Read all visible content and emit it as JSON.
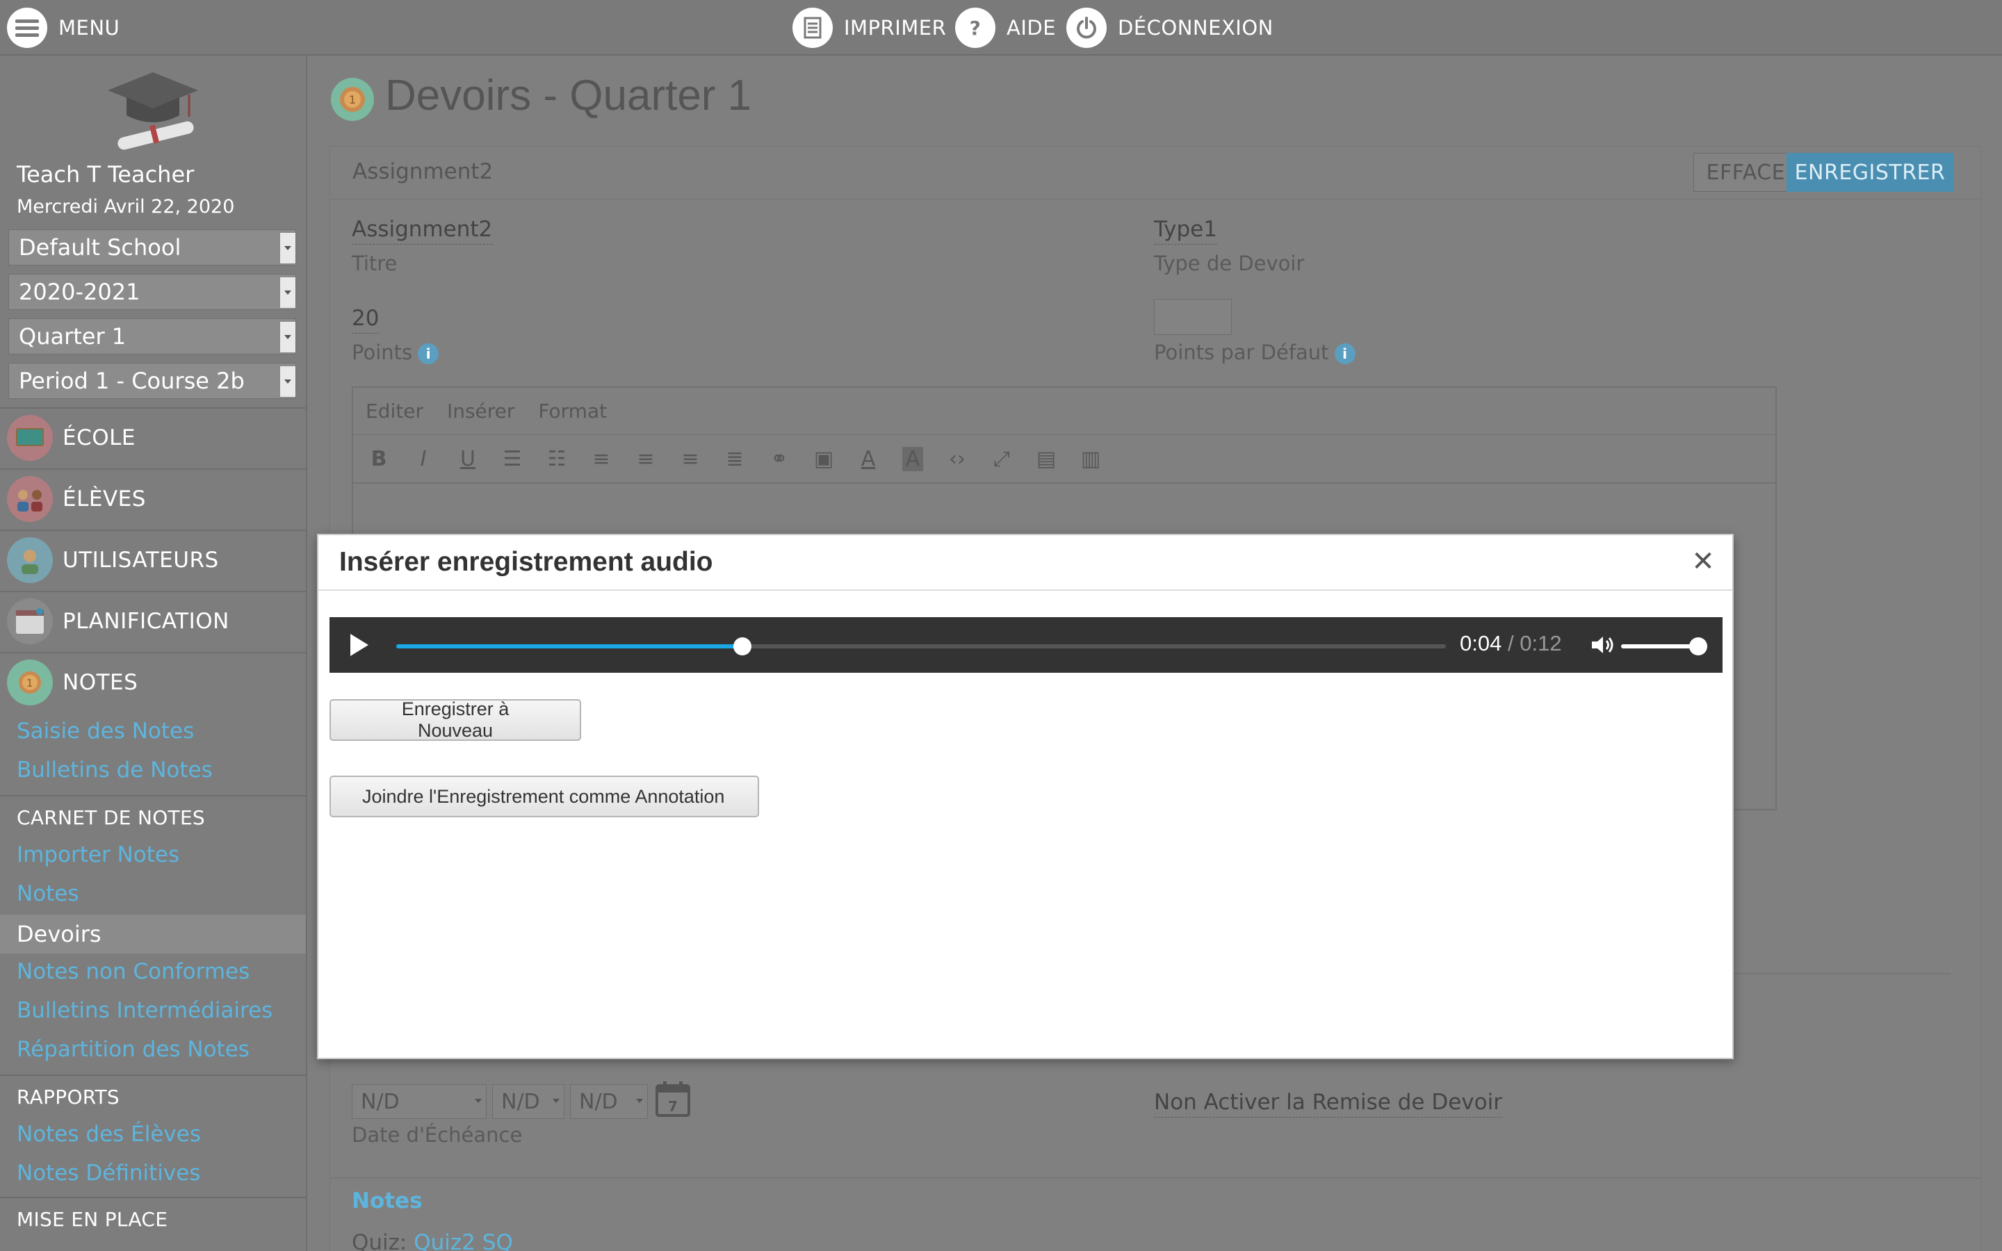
{
  "topbar": {
    "menu_label": "MENU",
    "print_label": "IMPRIMER",
    "help_label": "AIDE",
    "logout_label": "DÉCONNEXION"
  },
  "user": {
    "name": "Teach T Teacher",
    "date": "Mercredi Avril 22, 2020"
  },
  "selectors": {
    "school": "Default School",
    "year": "2020-2021",
    "term": "Quarter 1",
    "period": "Period 1 - Course 2b"
  },
  "nav": {
    "school": "ÉCOLE",
    "students": "ÉLÈVES",
    "users": "UTILISATEURS",
    "planning": "PLANIFICATION",
    "grades": "NOTES"
  },
  "grades_links": {
    "entry": "Saisie des Notes",
    "report_cards": "Bulletins de Notes"
  },
  "gradebook": {
    "heading": "CARNET DE NOTES",
    "import": "Importer Notes",
    "grades": "Notes",
    "assignments": "Devoirs",
    "noncompliant": "Notes non Conformes",
    "progress": "Bulletins Intermédiaires",
    "distribution": "Répartition des Notes"
  },
  "reports": {
    "heading": "RAPPORTS",
    "student_grades": "Notes des Élèves",
    "final_grades": "Notes Définitives"
  },
  "setup": {
    "heading": "MISE EN PLACE"
  },
  "page": {
    "title": "Devoirs - Quarter 1",
    "assignment_header": "Assignment2",
    "clear_button": "EFFACER",
    "save_button": "ENREGISTRER"
  },
  "form": {
    "title_value": "Assignment2",
    "title_label": "Titre",
    "type_value": "Type1",
    "type_label": "Type de Devoir",
    "points_value": "20",
    "points_label": "Points",
    "default_points_value": "",
    "default_points_label": "Points par Défaut",
    "due_month": "N/D",
    "due_day": "N/D",
    "due_year": "N/D",
    "due_label": "Date d'Échéance",
    "calendar_day": "7",
    "submission_value": "Non Activer la Remise de Devoir",
    "notes_heading": "Notes",
    "quiz_label": "Quiz:",
    "quiz_link": "Quiz2 SQ"
  },
  "editor": {
    "menu": [
      "Editer",
      "Insérer",
      "Format"
    ]
  },
  "modal": {
    "title": "Insérer enregistrement audio",
    "current_time": "0:04",
    "separator": "/",
    "duration": "0:12",
    "progress": 0.33,
    "volume": 1.0,
    "record_again_button": "Enregistrer à Nouveau",
    "attach_button": "Joindre l'Enregistrement comme Annotation"
  },
  "colors": {
    "link": "#5db5de",
    "progress": "#19a7e7",
    "save": "#4a8fb1"
  }
}
